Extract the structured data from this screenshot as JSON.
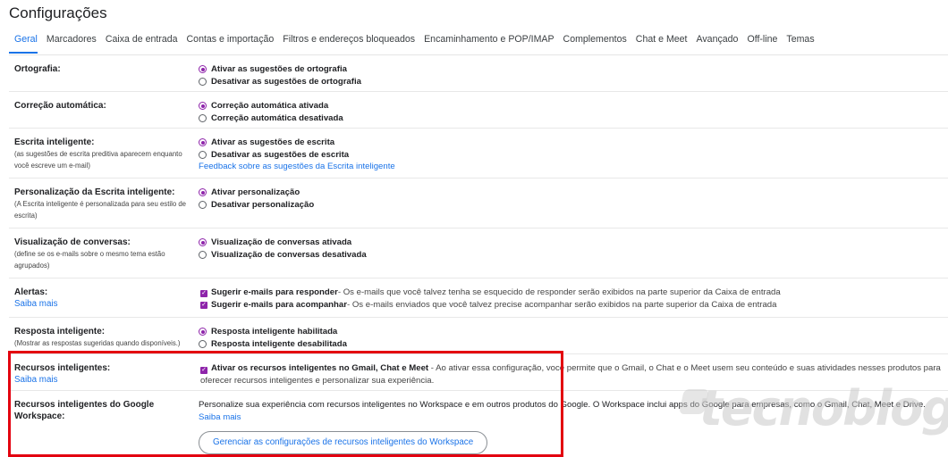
{
  "header": {
    "title": "Configurações"
  },
  "tabs": [
    "Geral",
    "Marcadores",
    "Caixa de entrada",
    "Contas e importação",
    "Filtros e endereços bloqueados",
    "Encaminhamento e POP/IMAP",
    "Complementos",
    "Chat e Meet",
    "Avançado",
    "Off-line",
    "Temas"
  ],
  "active_tab": "Geral",
  "accent_color": "#1a73e8",
  "control_color": "#8e24aa",
  "highlight_color": "#e3000f",
  "settings": {
    "ortografia": {
      "label": "Ortografia:",
      "opt1": "Ativar as sugestões de ortografia",
      "opt2": "Desativar as sugestões de ortografia",
      "selected": 1
    },
    "correcao": {
      "label": "Correção automática:",
      "opt1": "Correção automática ativada",
      "opt2": "Correção automática desativada",
      "selected": 1
    },
    "escrita": {
      "label": "Escrita inteligente:",
      "sub1": "(as sugestões de escrita preditiva aparecem enquanto",
      "sub2": "você escreve um e-mail)",
      "opt1": "Ativar as sugestões de escrita",
      "opt2": "Desativar as sugestões de escrita",
      "link": "Feedback sobre as sugestões da Escrita inteligente",
      "selected": 1
    },
    "personalizacao": {
      "label": "Personalização da Escrita inteligente:",
      "sub1": "(A Escrita inteligente é personalizada para seu estilo de",
      "sub2": "escrita)",
      "opt1": "Ativar personalização",
      "opt2": "Desativar personalização",
      "selected": 1
    },
    "conversas": {
      "label": "Visualização de conversas:",
      "sub1": "(define se os e-mails sobre o mesmo tema estão",
      "sub2": "agrupados)",
      "opt1": "Visualização de conversas ativada",
      "opt2": "Visualização de conversas desativada",
      "selected": 1
    },
    "alertas": {
      "label": "Alertas:",
      "link": "Saiba mais",
      "opt1_bold": "Sugerir e-mails para responder",
      "opt1_desc": " - Os e-mails que você talvez tenha se esquecido de responder serão exibidos na parte superior da Caixa de entrada",
      "opt2_bold": "Sugerir e-mails para acompanhar",
      "opt2_desc": " - Os e-mails enviados que você talvez precise acompanhar serão exibidos na parte superior da Caixa de entrada",
      "checked": [
        true,
        true
      ]
    },
    "resposta": {
      "label": "Resposta inteligente:",
      "sub1": "(Mostrar as respostas sugeridas quando disponíveis.)",
      "opt1": "Resposta inteligente habilitada",
      "opt2": "Resposta inteligente desabilitada",
      "selected": 1
    },
    "recursos": {
      "label": "Recursos inteligentes:",
      "link": "Saiba mais",
      "opt_bold": "Ativar os recursos inteligentes no Gmail, Chat e Meet",
      "opt_desc": " - Ao ativar essa configuração, você permite que o Gmail, o Chat e o Meet usem seu conteúdo e suas atividades nesses produtos para oferecer recursos inteligentes e personalizar sua experiência.",
      "checked": true
    },
    "workspace": {
      "label": "Recursos inteligentes do Google Workspace:",
      "text": "Personalize sua experiência com recursos inteligentes no Workspace e em outros produtos do Google. O Workspace inclui apps do Google para empresas, como o Gmail, Chat, Meet e Drive.",
      "link": "Saiba mais",
      "button": "Gerenciar as configurações de recursos inteligentes do Workspace"
    }
  },
  "watermark": "tecnoblog"
}
